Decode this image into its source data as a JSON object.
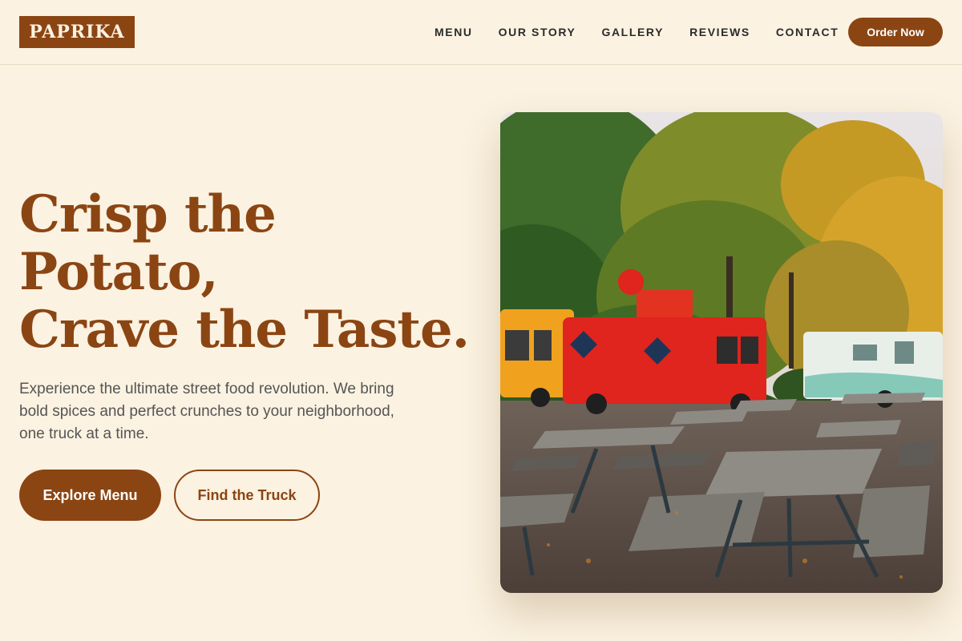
{
  "brand": {
    "logo_text": "PAPRIKA"
  },
  "nav": {
    "links": [
      "MENU",
      "OUR STORY",
      "GALLERY",
      "REVIEWS",
      "CONTACT"
    ],
    "cta": "Order Now"
  },
  "hero": {
    "headline_lines": [
      "Crisp the",
      "Potato,",
      "Crave the Taste."
    ],
    "description": "Experience the ultimate street food revolution. We bring bold spices and perfect crunches to your neighborhood, one truck at a time.",
    "primary_button": "Explore Menu",
    "secondary_button": "Find the Truck"
  },
  "colors": {
    "background": "#fbf2e1",
    "brand": "#8b4513",
    "text": "#555555"
  }
}
